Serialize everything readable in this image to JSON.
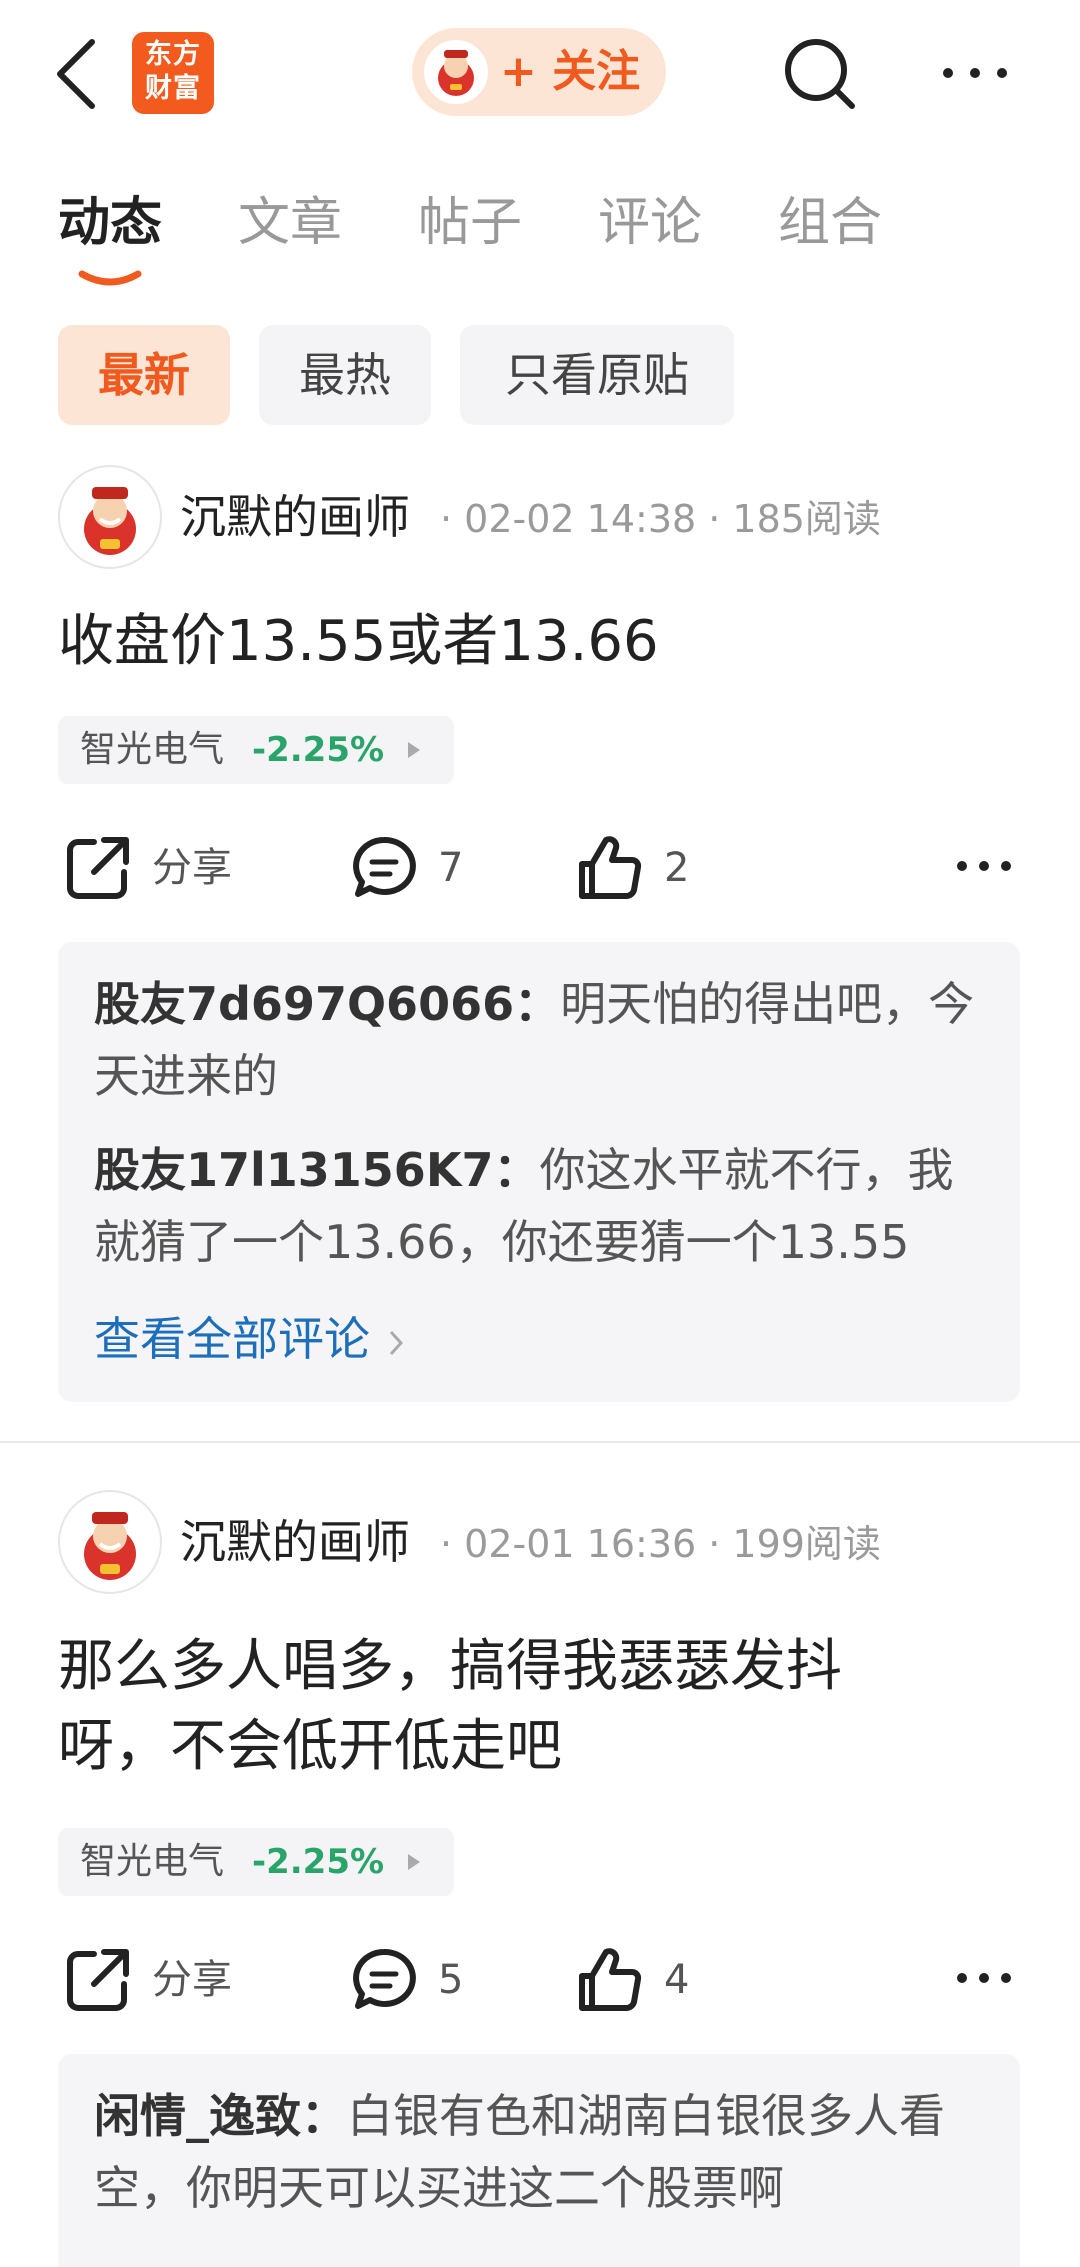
{
  "header": {
    "logo_line1": "东方",
    "logo_line2": "财富",
    "follow_label": "+ 关注"
  },
  "tabs": [
    {
      "label": "动态",
      "active": true
    },
    {
      "label": "文章",
      "active": false
    },
    {
      "label": "帖子",
      "active": false
    },
    {
      "label": "评论",
      "active": false
    },
    {
      "label": "组合",
      "active": false
    }
  ],
  "filters": [
    {
      "label": "最新",
      "active": true
    },
    {
      "label": "最热",
      "active": false
    },
    {
      "label": "只看原贴",
      "active": false
    }
  ],
  "accent_color": "#f05a1e",
  "down_color": "#2aa56a",
  "posts": [
    {
      "author": "沉默的画师",
      "meta": "· 02-02 14:38 · 185阅读",
      "text": "收盘价13.55或者13.66",
      "stock_name": "智光电气",
      "stock_change": "-2.25%",
      "share_label": "分享",
      "comment_count": "7",
      "like_count": "2",
      "comments": [
        {
          "user": "股友7d697Q6066",
          "sep": "：",
          "text": "明天怕的得出吧，今天进来的"
        },
        {
          "user": "股友17l13156K7",
          "sep": "：",
          "text": "你这水平就不行，我就猜了一个13.66，你还要猜一个13.55"
        }
      ],
      "view_all": "查看全部评论"
    },
    {
      "author": "沉默的画师",
      "meta": "· 02-01 16:36 · 199阅读",
      "text": "那么多人唱多，搞得我瑟瑟发抖呀，不会低开低走吧",
      "stock_name": "智光电气",
      "stock_change": "-2.25%",
      "share_label": "分享",
      "comment_count": "5",
      "like_count": "4",
      "comments": [
        {
          "user": "闲情_逸致",
          "sep": "：",
          "text": "白银有色和湖南白银很多人看空，你明天可以买进这二个股票啊"
        }
      ]
    }
  ]
}
